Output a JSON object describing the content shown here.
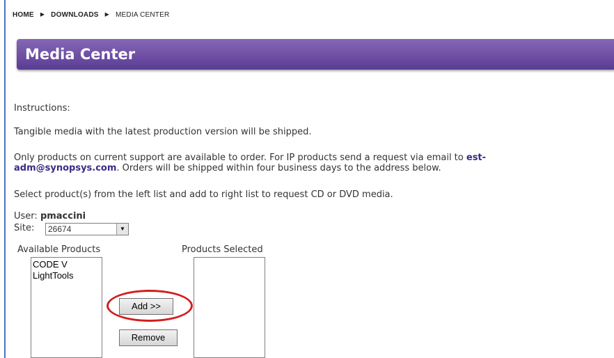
{
  "breadcrumb": {
    "home": "HOME",
    "downloads": "DOWNLOADS",
    "current": "MEDIA CENTER"
  },
  "header": {
    "title": "Media Center"
  },
  "instructions": {
    "heading": "Instructions:",
    "p1": "Tangible media with the latest production version will be shipped.",
    "p2_line1_before": "Only products on current support are available to order. For IP products send a request via email to ",
    "p2_link1": "est-",
    "p2_link2": "adm@synopsys.com",
    "p2_line2_after": ". Orders will be shipped within four business days to the address below.",
    "p3": "Select product(s) from the left list and add to right list to request CD or DVD media."
  },
  "user": {
    "label": "User:",
    "value": "pmaccini"
  },
  "site": {
    "label": "Site:",
    "value": "26674"
  },
  "available": {
    "label": "Available Products",
    "items": [
      "CODE V",
      "LightTools"
    ]
  },
  "selected": {
    "label": "Products Selected"
  },
  "buttons": {
    "add": "Add >>",
    "remove": "Remove"
  },
  "colors": {
    "header": "#6e4fa4",
    "link": "#3a2a86",
    "highlight": "#d21f1f"
  }
}
